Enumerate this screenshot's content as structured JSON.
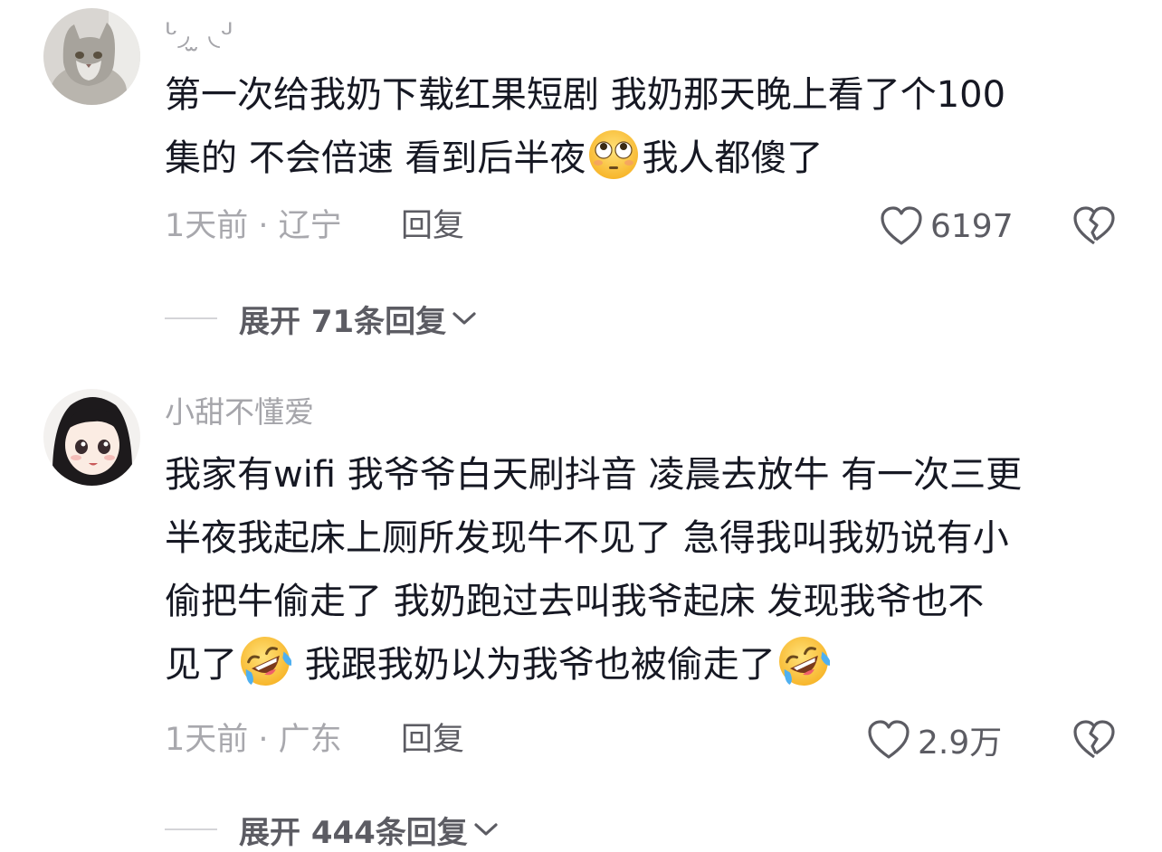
{
  "comments": [
    {
      "username": "ᒡ◞ ̫ ◟ᒢ",
      "lines": [
        [
          "第一次给我奶下载红果短剧 我奶那天晚上看了个100"
        ],
        [
          "集的 不会倍速 看到后半夜",
          "我人都傻了"
        ]
      ],
      "time_location": "1天前 · 辽宁",
      "reply_label": "回复",
      "like_count": "6197",
      "expand_label": "展开 71条回复"
    },
    {
      "username": "小甜不懂爱",
      "lines": [
        [
          "我家有wifi 我爷爷白天刷抖音 凌晨去放牛 有一次三更"
        ],
        [
          "半夜我起床上厕所发现牛不见了 急得我叫我奶说有小"
        ],
        [
          "偷把牛偷走了 我奶跑过去叫我爷起床 发现我爷也不"
        ],
        [
          "见了",
          " 我跟我奶以为我爷也被偷走了"
        ]
      ],
      "time_location": "1天前 · 广东",
      "reply_label": "回复",
      "like_count": "2.9万",
      "expand_label": "展开 444条回复"
    }
  ],
  "icons": {
    "comment1_emoji": "flushed-face-emoji",
    "comment2_emoji": "rolling-on-floor-laughing-emoji",
    "like": "heart-outline-icon",
    "dislike": "broken-heart-icon",
    "expand": "chevron-down-icon"
  }
}
